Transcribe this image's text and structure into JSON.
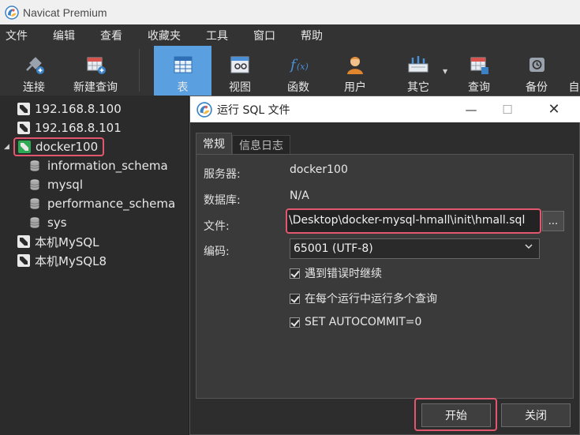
{
  "app": {
    "title": "Navicat Premium"
  },
  "menu": [
    "文件",
    "编辑",
    "查看",
    "收藏夹",
    "工具",
    "窗口",
    "帮助"
  ],
  "toolbar": {
    "connect": "连接",
    "new_query": "新建查询",
    "table": "表",
    "view": "视图",
    "function": "函数",
    "user": "用户",
    "other": "其它",
    "query": "查询",
    "backup": "备份",
    "auto": "自"
  },
  "tree": {
    "conn1": "192.168.8.100",
    "conn2": "192.168.8.101",
    "conn3": "docker100",
    "db1": "information_schema",
    "db2": "mysql",
    "db3": "performance_schema",
    "db4": "sys",
    "conn4": "本机MySQL",
    "conn5": "本机MySQL8"
  },
  "dialog": {
    "title": "运行 SQL 文件",
    "tab_general": "常规",
    "tab_log": "信息日志",
    "server_label": "服务器:",
    "server_value": "docker100",
    "database_label": "数据库:",
    "database_value": "N/A",
    "file_label": "文件:",
    "file_value": "\\Desktop\\docker-mysql-hmall\\init\\hmall.sql",
    "browse": "...",
    "encoding_label": "编码:",
    "encoding_value": "65001 (UTF-8)",
    "opt_continue": "遇到错误时继续",
    "opt_multi": "在每个运行中运行多个查询",
    "opt_autocommit": "SET AUTOCOMMIT=0",
    "start": "开始",
    "close": "关闭"
  },
  "colors": {
    "accent": "#5aa0e0",
    "highlight": "#e2576d",
    "connected": "#2eaa55"
  }
}
